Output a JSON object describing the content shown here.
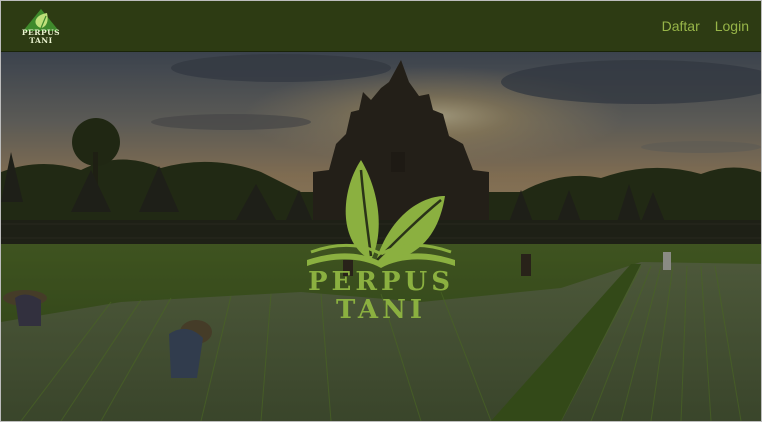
{
  "brand": {
    "name_line1": "PERPUS",
    "name_line2": "TANI",
    "icon": "leaf-book-icon"
  },
  "nav": {
    "links": [
      {
        "label": "Daftar"
      },
      {
        "label": "Login"
      }
    ]
  },
  "hero": {
    "title_line1": "PERPUS",
    "title_line2": "TANI",
    "logo_icon": "leaf-book-icon",
    "background": "photo-temple-rice-field"
  },
  "colors": {
    "navbar": "#2d3b13",
    "accent_green": "#8bb040",
    "link_green": "#97b548"
  }
}
